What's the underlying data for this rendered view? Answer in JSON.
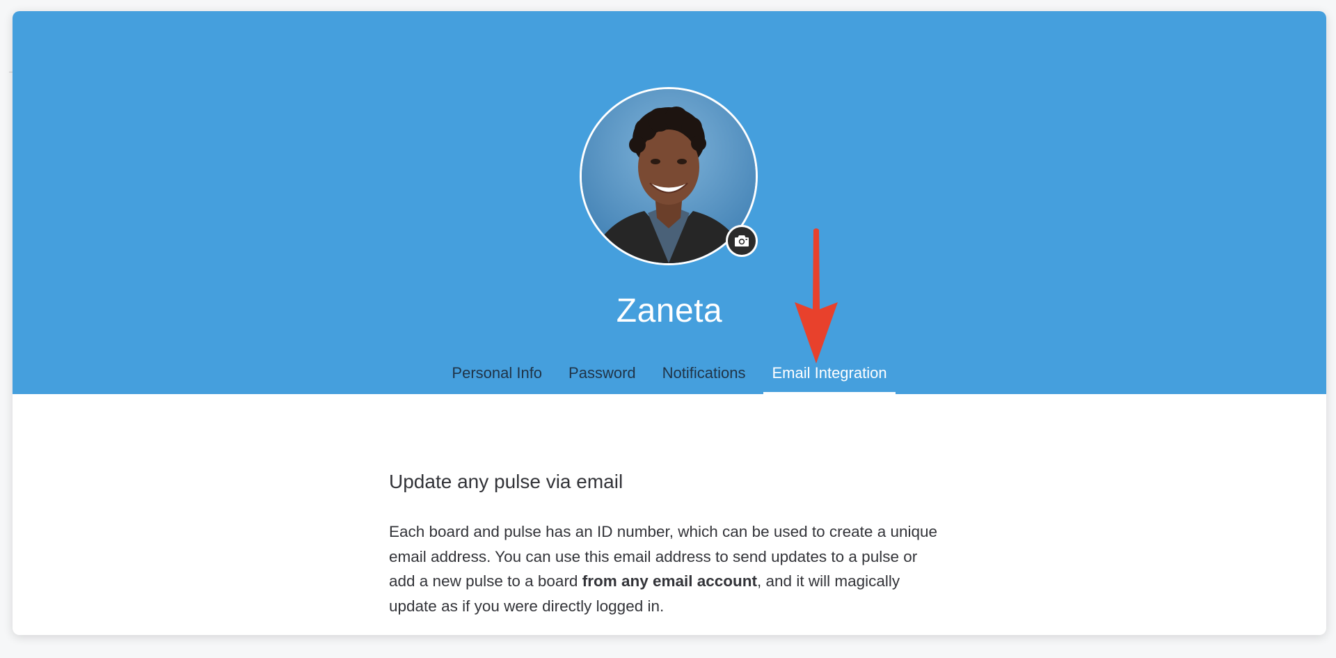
{
  "profile": {
    "name": "Zaneta",
    "avatar_alt": "Zaneta",
    "camera_icon": "camera-icon"
  },
  "tabs": [
    {
      "label": "Personal Info",
      "active": false
    },
    {
      "label": "Password",
      "active": false
    },
    {
      "label": "Notifications",
      "active": false
    },
    {
      "label": "Email Integration",
      "active": true
    }
  ],
  "email_integration": {
    "title": "Update any pulse via email",
    "description_before": "Each board and pulse has an ID number, which can be used to create a unique email address. You can use this email address to send updates to a pulse or add a new pulse to a board ",
    "description_bold": "from any email account",
    "description_after": ", and it will magically update as if you were directly logged in."
  },
  "annotation": {
    "arrow_color": "#e8412c",
    "arrow_icon": "arrow-down-icon"
  },
  "colors": {
    "header_bg": "#459fdd",
    "page_bg": "#ffffff",
    "tab_text": "#1f3347",
    "active_tab_text": "#ffffff"
  }
}
